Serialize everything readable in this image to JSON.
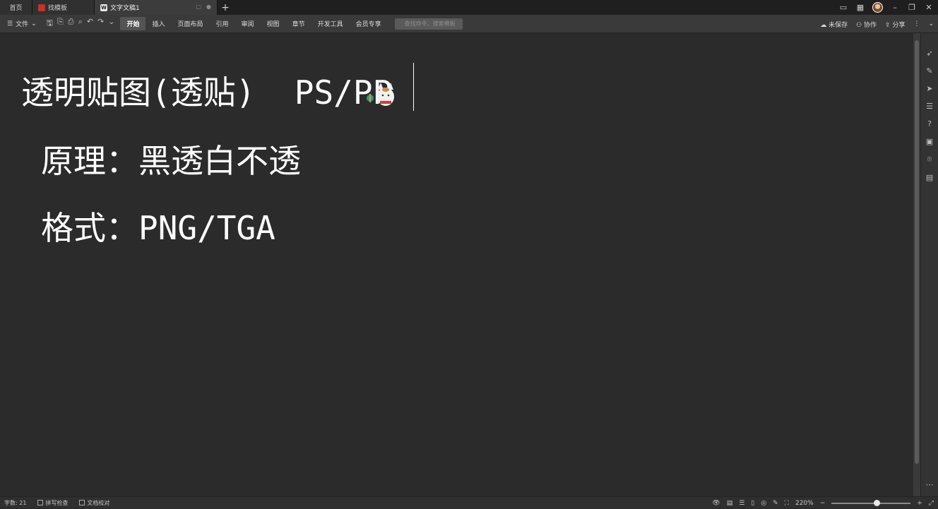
{
  "tabs": {
    "home": "首页",
    "templates": "找模板",
    "document": "文字文稿1"
  },
  "ribbon": {
    "file": "文件",
    "menus": [
      "开始",
      "插入",
      "页面布局",
      "引用",
      "审阅",
      "视图",
      "章节",
      "开发工具",
      "会员专享"
    ],
    "search_placeholder": "查找命令、搜索模板",
    "unsaved": "未保存",
    "collab": "协作",
    "share": "分享"
  },
  "document": {
    "line1": "透明贴图(透贴)  PS/PP",
    "line2": "原理：黑透白不透",
    "line3": "格式：PNG/TGA"
  },
  "status": {
    "word_count": "字数: 21",
    "spell_check": "拼写检查",
    "doc_proof": "文档校对",
    "zoom": "220%"
  }
}
